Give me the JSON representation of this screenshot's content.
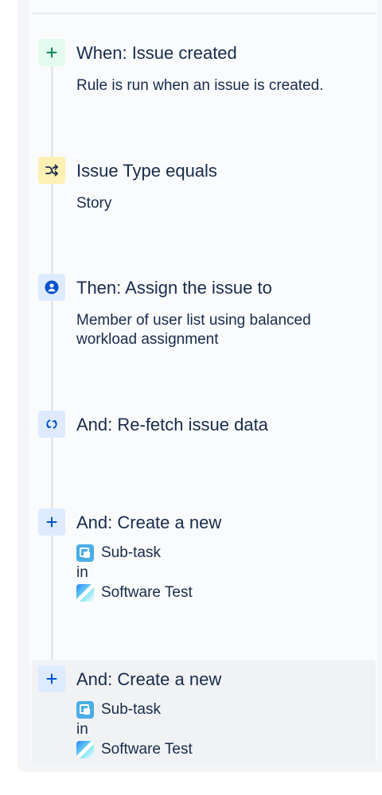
{
  "rule": {
    "components": [
      {
        "icon": "plus-icon",
        "title": "When: Issue created",
        "description": "Rule is run when an issue is created."
      },
      {
        "icon": "shuffle-icon",
        "title": "Issue Type equals",
        "description": "Story"
      },
      {
        "icon": "user-circle-icon",
        "title": "Then: Assign the issue to",
        "description": "Member of user list using balanced workload assignment"
      },
      {
        "icon": "refresh-icon",
        "title": "And: Re-fetch issue data"
      },
      {
        "icon": "plus-icon",
        "title": "And: Create a new",
        "issue_type": "Sub-task",
        "connector": "in",
        "project": "Software Test"
      },
      {
        "icon": "plus-icon",
        "title": "And: Create a new",
        "issue_type": "Sub-task",
        "connector": "in",
        "project": "Software Test",
        "selected": true
      }
    ]
  },
  "colors": {
    "trigger_icon_bg": "#e3fcef",
    "condition_icon_bg": "#fff0b3",
    "action_icon_bg": "#deebff",
    "text": "#172b4d"
  }
}
